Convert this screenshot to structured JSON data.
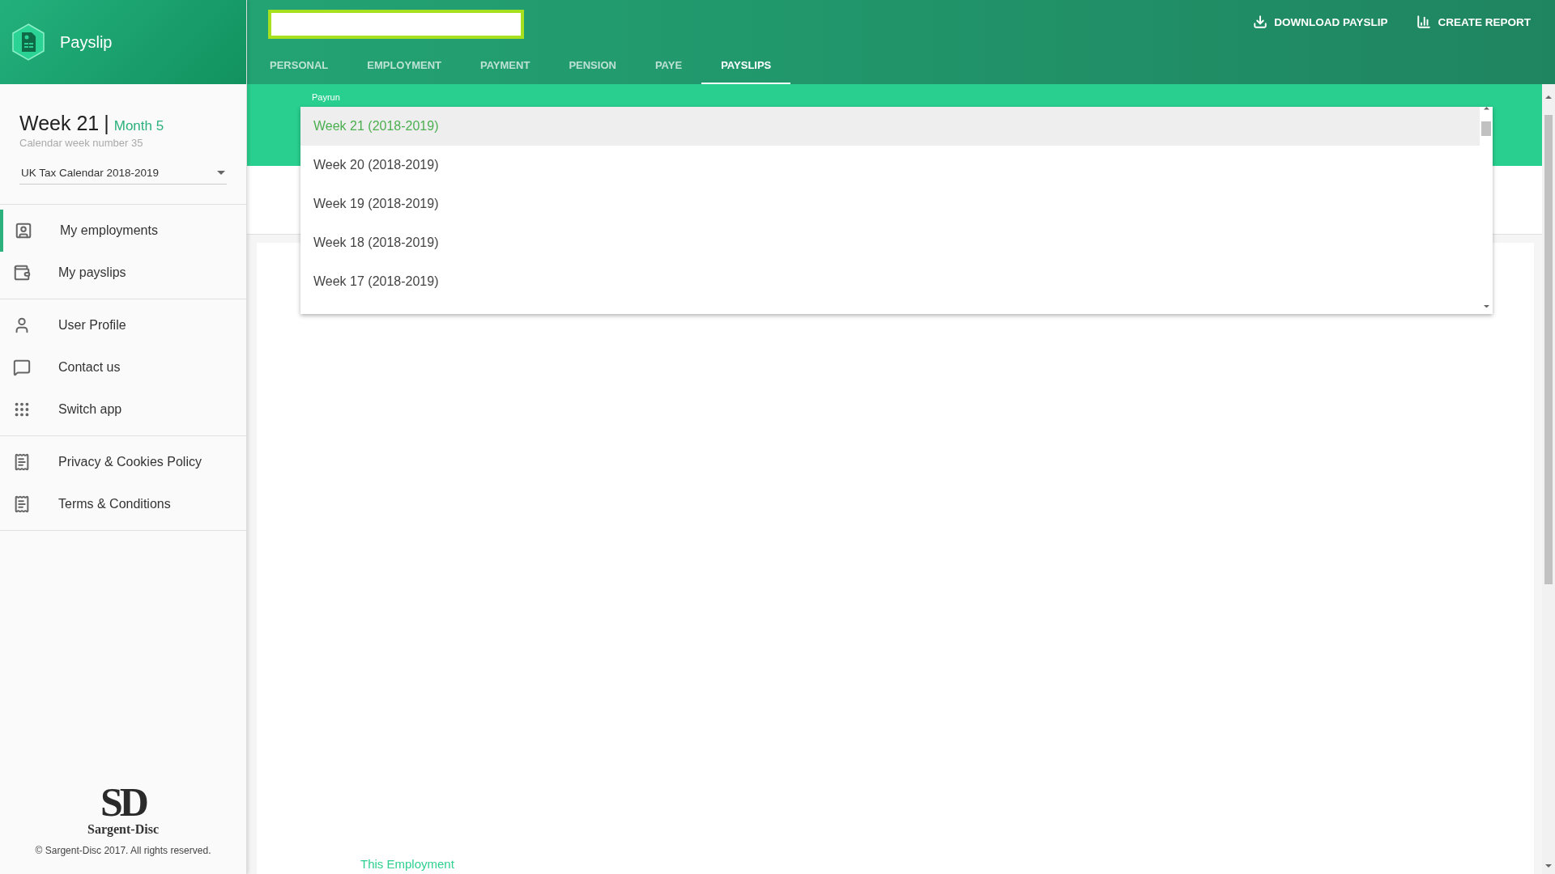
{
  "app": {
    "title": "Payslip"
  },
  "header_actions": [
    {
      "label": "DOWNLOAD PAYSLIP",
      "kind": "download"
    },
    {
      "label": "CREATE REPORT",
      "kind": "report"
    }
  ],
  "tabs": [
    {
      "label": "PERSONAL",
      "selected": false
    },
    {
      "label": "EMPLOYMENT",
      "selected": false
    },
    {
      "label": "PAYMENT",
      "selected": false
    },
    {
      "label": "PENSION",
      "selected": false
    },
    {
      "label": "PAYE",
      "selected": false
    },
    {
      "label": "PAYSLIPS",
      "selected": true
    }
  ],
  "period": {
    "week": "Week 21",
    "separator": "|",
    "month": "Month 5",
    "subtitle": "Calendar week number 35",
    "calendar": "UK Tax Calendar 2018-2019"
  },
  "nav_groups": [
    [
      {
        "label": "My employments",
        "kind": "employments",
        "selected": true
      },
      {
        "label": "My payslips",
        "kind": "payslips",
        "selected": false
      }
    ],
    [
      {
        "label": "User Profile",
        "kind": "profile",
        "selected": false
      },
      {
        "label": "Contact us",
        "kind": "contact",
        "selected": false
      },
      {
        "label": "Switch app",
        "kind": "apps",
        "selected": false
      }
    ],
    [
      {
        "label": "Privacy & Cookies Policy",
        "kind": "document",
        "selected": false
      },
      {
        "label": "Terms & Conditions",
        "kind": "document",
        "selected": false
      }
    ]
  ],
  "footer": {
    "logo_letters": "SD",
    "brand": "Sargent-Disc",
    "copyright": "© Sargent-Disc 2017. All rights reserved."
  },
  "payrun": {
    "label": "Payrun",
    "options": [
      {
        "label": "Week 21 (2018-2019)",
        "selected": true
      },
      {
        "label": "Week 20 (2018-2019)",
        "selected": false
      },
      {
        "label": "Week 19 (2018-2019)",
        "selected": false
      },
      {
        "label": "Week 18 (2018-2019)",
        "selected": false
      },
      {
        "label": "Week 17 (2018-2019)",
        "selected": false
      }
    ]
  },
  "content": {
    "link": "This Employment"
  }
}
